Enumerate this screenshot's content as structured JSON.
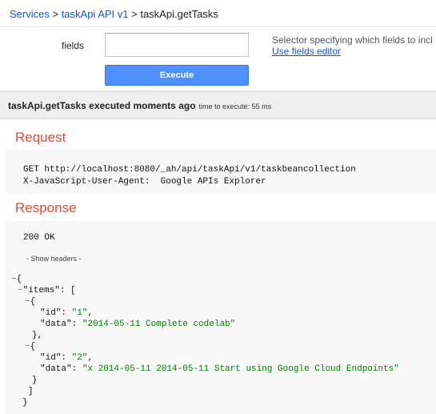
{
  "breadcrumb": {
    "services": "Services",
    "sep1": " > ",
    "api": "taskApi API v1",
    "sep2": " > ",
    "method": "taskApi.getTasks"
  },
  "fields": {
    "label": "fields",
    "value": "",
    "description": "Selector specifying which fields to incl",
    "editor_link": "Use fields editor"
  },
  "execute_label": "Execute",
  "status": {
    "message": "taskApi.getTasks executed moments ago",
    "time": "time to execute: 55 ms"
  },
  "request": {
    "title": "Request",
    "line1": "GET http://localhost:8080/_ah/api/taskApi/v1/taskbeancollection",
    "line2": "X-JavaScript-User-Agent:  Google APIs Explorer"
  },
  "response": {
    "title": "Response",
    "status": "200 OK",
    "show_headers": "- Show headers -",
    "items_key": "\"items\"",
    "items": [
      {
        "id": "\"1\"",
        "data": "\"2014-05-11 Complete codelab\""
      },
      {
        "id": "\"2\"",
        "data": "\"x 2014-05-11 2014-05-11 Start using Google Cloud Endpoints\""
      }
    ]
  }
}
